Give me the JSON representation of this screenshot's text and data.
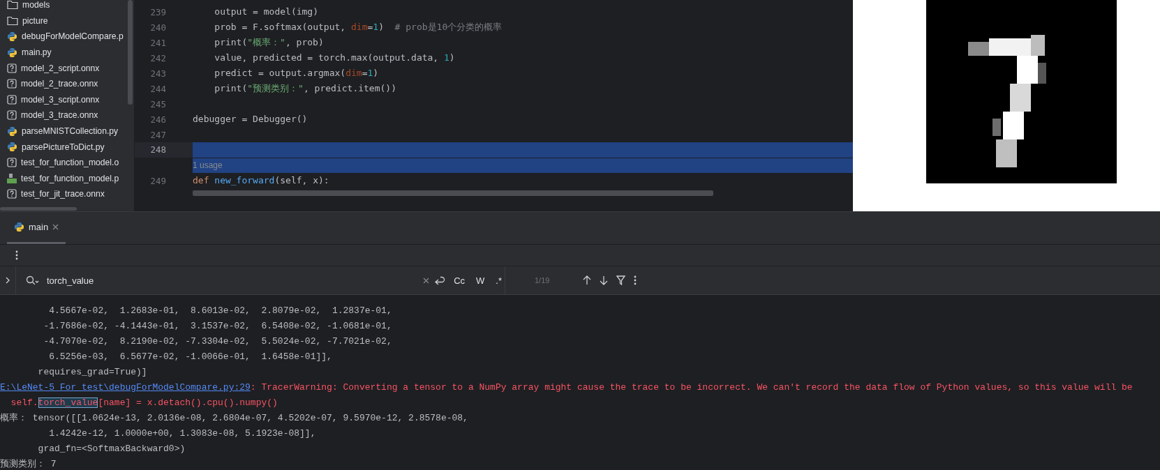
{
  "project_tree": {
    "items": [
      {
        "name": "models",
        "kind": "folder"
      },
      {
        "name": "picture",
        "kind": "folder"
      },
      {
        "name": "debugForModelCompare.p",
        "kind": "python"
      },
      {
        "name": "main.py",
        "kind": "python"
      },
      {
        "name": "model_2_script.onnx",
        "kind": "unknown"
      },
      {
        "name": "model_2_trace.onnx",
        "kind": "unknown"
      },
      {
        "name": "model_3_script.onnx",
        "kind": "unknown"
      },
      {
        "name": "model_3_trace.onnx",
        "kind": "unknown"
      },
      {
        "name": "parseMNISTCollection.py",
        "kind": "python"
      },
      {
        "name": "parsePictureToDict.py",
        "kind": "python"
      },
      {
        "name": "test_for_function_model.o",
        "kind": "unknown"
      },
      {
        "name": "test_for_function_model.p",
        "kind": "binary"
      },
      {
        "name": "test_for_jit_trace.onnx",
        "kind": "unknown"
      }
    ]
  },
  "editor": {
    "lines": [
      {
        "number": "239",
        "selected": false,
        "tokens": [
          {
            "text": "    output = model(img)",
            "kind": "plain"
          }
        ]
      },
      {
        "number": "240",
        "selected": false,
        "tokens": [
          {
            "text": "    prob = F.softmax(output, ",
            "kind": "plain"
          },
          {
            "text": "dim",
            "kind": "param"
          },
          {
            "text": "=",
            "kind": "plain"
          },
          {
            "text": "1",
            "kind": "number"
          },
          {
            "text": ")  ",
            "kind": "plain"
          },
          {
            "text": "# prob是10个分类的概率",
            "kind": "comment"
          }
        ]
      },
      {
        "number": "241",
        "selected": false,
        "tokens": [
          {
            "text": "    print(",
            "kind": "plain"
          },
          {
            "text": "\"概率：\"",
            "kind": "string"
          },
          {
            "text": ", prob)",
            "kind": "plain"
          }
        ]
      },
      {
        "number": "242",
        "selected": false,
        "tokens": [
          {
            "text": "    value, predicted = torch.max(output.data, ",
            "kind": "plain"
          },
          {
            "text": "1",
            "kind": "number"
          },
          {
            "text": ")",
            "kind": "plain"
          }
        ]
      },
      {
        "number": "243",
        "selected": false,
        "tokens": [
          {
            "text": "    predict = output.argmax(",
            "kind": "plain"
          },
          {
            "text": "dim",
            "kind": "param"
          },
          {
            "text": "=",
            "kind": "plain"
          },
          {
            "text": "1",
            "kind": "number"
          },
          {
            "text": ")",
            "kind": "plain"
          }
        ]
      },
      {
        "number": "244",
        "selected": false,
        "tokens": [
          {
            "text": "    print(",
            "kind": "plain"
          },
          {
            "text": "\"预测类别：\"",
            "kind": "string"
          },
          {
            "text": ", predict.item())",
            "kind": "plain"
          }
        ]
      },
      {
        "number": "245",
        "selected": false
      },
      {
        "number": "246",
        "selected": false,
        "tokens": [
          {
            "text": "debugger = Debugger()",
            "kind": "plain"
          }
        ]
      },
      {
        "number": "247",
        "selected": false
      },
      {
        "number": "248",
        "selected": true
      },
      {
        "number": "249",
        "selected": false,
        "hint": "1 usage",
        "tokens": [
          {
            "text": "def ",
            "kind": "keyword"
          },
          {
            "text": "new_forward",
            "kind": "function"
          },
          {
            "text": "(self, x):",
            "kind": "plain"
          }
        ]
      }
    ]
  },
  "run_panel": {
    "tabs": [
      {
        "label": "main",
        "selected": true
      }
    ],
    "search": {
      "value": "torch_value",
      "options": [
        {
          "label": "Cc",
          "selected": false
        },
        {
          "label": "W",
          "selected": false
        },
        {
          "label": ".*",
          "selected": false
        }
      ],
      "count": "1/19"
    },
    "console": [
      [
        {
          "text": "         4.5667e-02,  1.2683e-01,  8.6013e-02,  2.8079e-02,  1.2837e-01,",
          "kind": "plain"
        }
      ],
      [
        {
          "text": "        -1.7686e-02, -4.1443e-01,  3.1537e-02,  6.5408e-02, -1.0681e-01,",
          "kind": "plain"
        }
      ],
      [
        {
          "text": "        -4.7070e-02,  8.2190e-02, -7.3304e-02,  5.5024e-02, -7.7021e-02,",
          "kind": "plain"
        }
      ],
      [
        {
          "text": "         6.5256e-03,  6.5677e-02, -1.0066e-01,  1.6458e-01]],",
          "kind": "plain"
        }
      ],
      [
        {
          "text": "       requires_grad=True)]",
          "kind": "plain"
        }
      ],
      [
        {
          "text": "E:\\LeNet-5_For_test\\debugForModelCompare.py:29",
          "kind": "link"
        },
        {
          "text": ": TracerWarning: Converting a tensor to a NumPy array might cause the trace to be incorrect. We can't record the data flow of Python values, so this value will be",
          "kind": "error"
        }
      ],
      [
        {
          "text": "  self.",
          "kind": "error"
        },
        {
          "text": "torch_value",
          "kind": "match"
        },
        {
          "text": "[name] = x.detach().cpu().numpy()",
          "kind": "error"
        }
      ],
      [
        {
          "text": "概率： tensor([[1.0624e-13, 2.0136e-08, 2.6804e-07, 4.5202e-07, 9.5970e-12, 2.8578e-08,",
          "kind": "plain"
        }
      ],
      [
        {
          "text": "         1.4242e-12, 1.0000e+00, 1.3083e-08, 5.1923e-08]],",
          "kind": "plain"
        }
      ],
      [
        {
          "text": "       grad_fn=<SoftmaxBackward0>)",
          "kind": "plain"
        }
      ],
      [
        {
          "text": "预测类别： 7",
          "kind": "plain"
        }
      ]
    ]
  }
}
